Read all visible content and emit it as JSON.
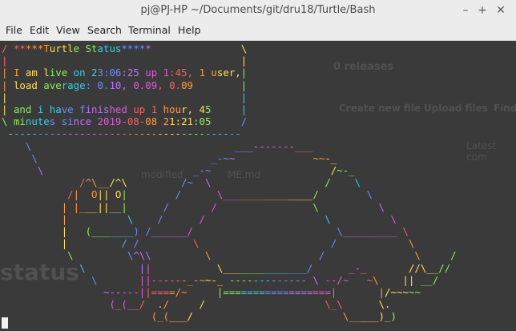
{
  "window": {
    "title": "pj@PJ-HP ~/Documents/git/dru18/Turtle/Bash",
    "minimize": "–",
    "maximize": "+",
    "close": "✕"
  },
  "menu": [
    "File",
    "Edit",
    "View",
    "Search",
    "Terminal",
    "Help"
  ],
  "background_ghost": {
    "releases": "0 releases",
    "create_new_file": "Create new file",
    "upload_files": "Upload files",
    "find": "Find",
    "latest": "Latest com",
    "modified": "modified",
    "readme": "ME.md",
    "status": "status"
  },
  "bubble_lines": [
    "/ *****Turtle Status*****               \\",
    "|                                       |",
    "| I am live on 23:06:25 up 1:45, 1 user,|",
    "| load average: 0.10, 0.09, 0.09        |",
    "|                                       |",
    "| and i have finished up 1 hour, 45     |",
    "\\ minutes since 2019-08-08 21:21:05     /",
    " ---------------------------------------"
  ],
  "turtle_lines": [
    "    \\                                  ___-------___",
    "     \\                             _-~~             ~~-_",
    "      \\                         _-~                    /~-_",
    "             /^\\__/^\\         /~  \\                   /    \\",
    "           /|  O|| O|        /      \\_______________/        \\",
    "          | |___||__|      /       /                \\          \\",
    "          |          \\    /      /                    \\          \\",
    "          |   (_______) /______/                        \\_________ \\",
    "          |         / /         \\                      /            \\",
    "           \\         \\^\\\\         \\                  /               \\     /",
    "             \\         ||           \\______________/      _-_       //\\__//",
    "               \\       ||------_-~~-_ ------------- \\ --/~   ~\\    || __/",
    "                 ~-----||====/~     |==================|       |/~~~~~",
    "                  (_(__/  ./     /                    \\_\\      \\.",
    "                         (_(___/                         \\_____)_)"
  ]
}
